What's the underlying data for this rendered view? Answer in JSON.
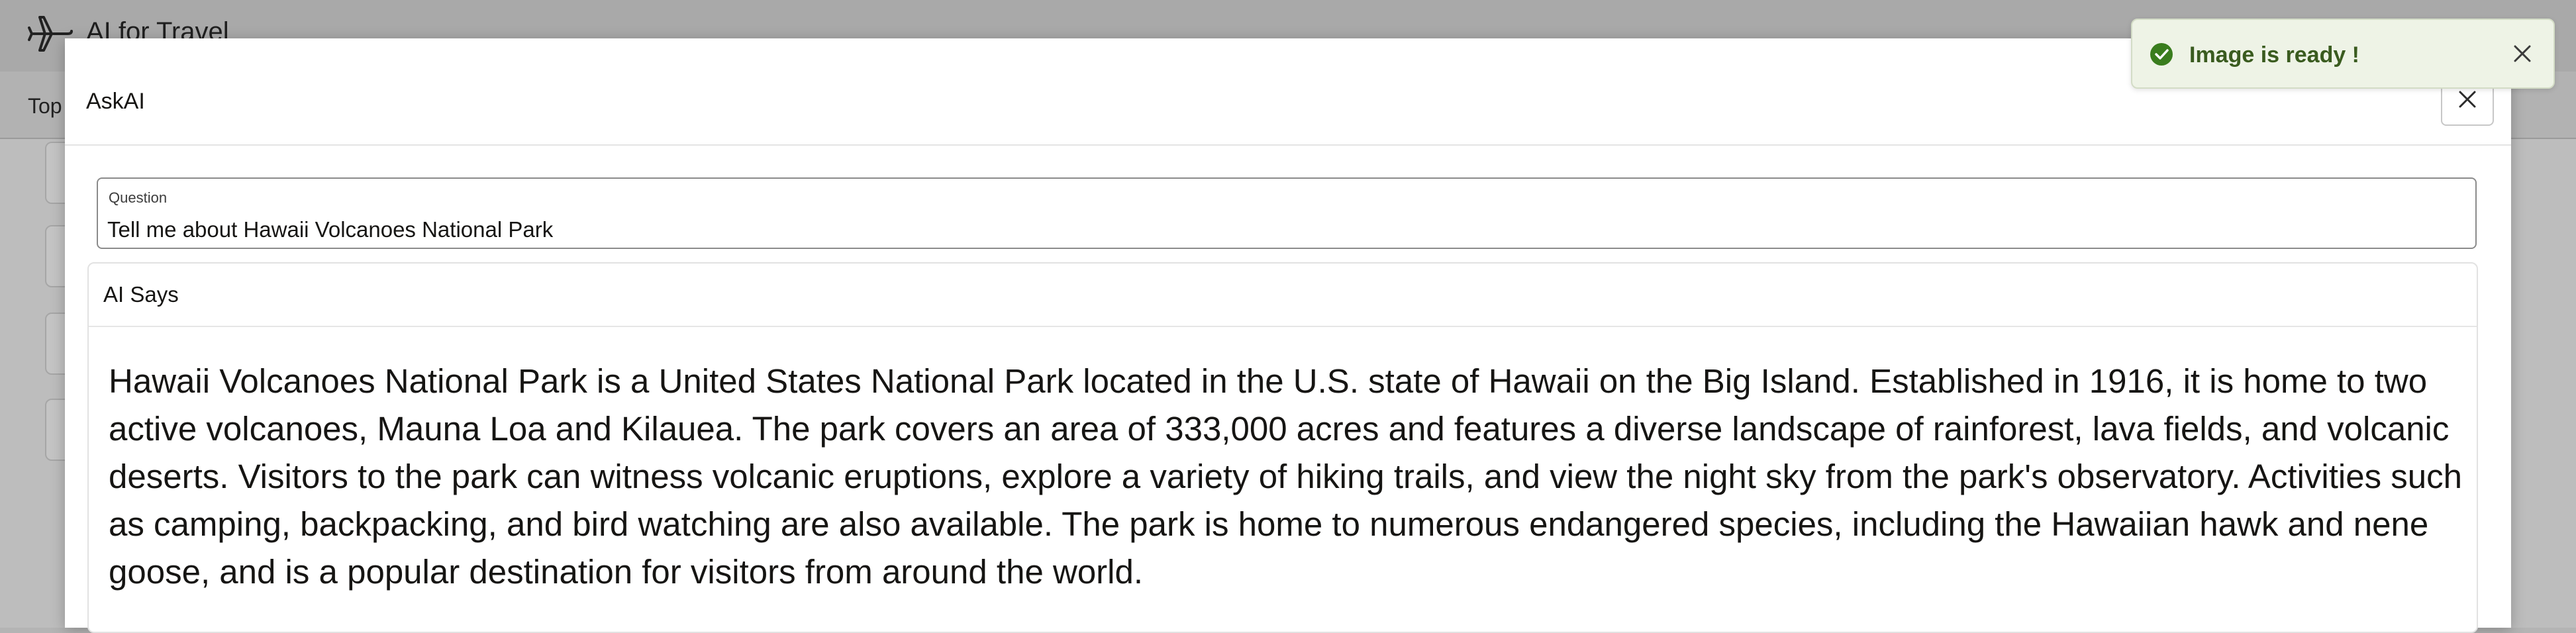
{
  "app": {
    "title": "AI for Travel",
    "subnav_label": "Top",
    "logo_icon": "airplane-icon"
  },
  "dialog": {
    "title": "AskAI",
    "close_icon": "close-icon",
    "question": {
      "label": "Question",
      "value": "Tell me about Hawaii Volcanoes National Park"
    },
    "ai_panel": {
      "title": "AI Says",
      "answer": "Hawaii Volcanoes National Park is a United States National Park located in the U.S. state of Hawaii on the Big Island. Established in 1916, it is home to two active volcanoes, Mauna Loa and Kilauea. The park covers an area of 333,000 acres and features a diverse landscape of rainforest, lava fields, and volcanic deserts. Visitors to the park can witness volcanic eruptions, explore a variety of hiking trails, and view the night sky from the park's observatory. Activities such as camping, backpacking, and bird watching are also available. The park is home to numerous endangered species, including the Hawaiian hawk and nene goose, and is a popular destination for visitors from around the world."
    }
  },
  "toast": {
    "message": "Image is ready !",
    "status_icon": "success-check-icon",
    "close_icon": "close-icon",
    "accent_color": "#3a7d1e"
  }
}
